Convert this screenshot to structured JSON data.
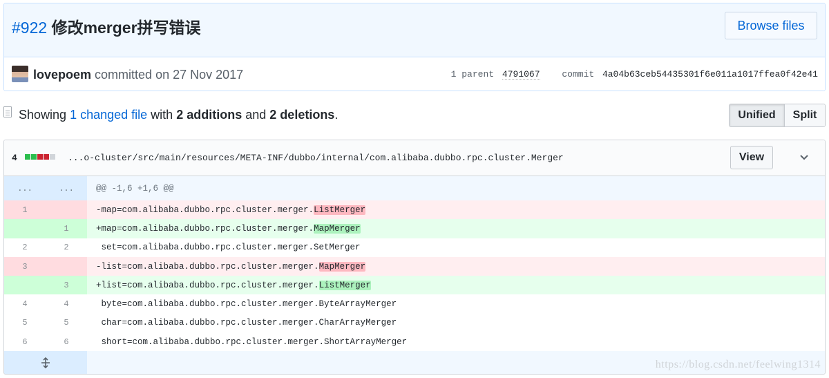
{
  "commit": {
    "pr_number": "#922",
    "title": "修改merger拼写错误",
    "browse_label": "Browse files",
    "author": "lovepoem",
    "committed_text": "committed on 27 Nov 2017",
    "parent_label": "1 parent",
    "parent_sha": "4791067",
    "commit_label": "commit",
    "commit_sha": "4a04b63ceb54435301f6e011a1017ffea0f42e41"
  },
  "toc": {
    "showing": "Showing",
    "changed_link": "1 changed file",
    "with": "with",
    "additions": "2 additions",
    "and": "and",
    "deletions": "2 deletions",
    "period": ".",
    "view_unified": "Unified",
    "view_split": "Split"
  },
  "file": {
    "change_count": "4",
    "path": "...o-cluster/src/main/resources/META-INF/dubbo/internal/com.alibaba.dubbo.rpc.cluster.Merger",
    "view_label": "View",
    "hunk": {
      "left": "...",
      "right": "...",
      "text": "@@ -1,6 +1,6 @@"
    },
    "lines": [
      {
        "type": "del",
        "old": "1",
        "new": "",
        "prefix": "-map=com.alibaba.dubbo.rpc.cluster.merger.",
        "hl": "ListMerger"
      },
      {
        "type": "add",
        "old": "",
        "new": "1",
        "prefix": "+map=com.alibaba.dubbo.rpc.cluster.merger.",
        "hl": "MapMerger"
      },
      {
        "type": "ctx",
        "old": "2",
        "new": "2",
        "prefix": " set=com.alibaba.dubbo.rpc.cluster.merger.SetMerger",
        "hl": ""
      },
      {
        "type": "del",
        "old": "3",
        "new": "",
        "prefix": "-list=com.alibaba.dubbo.rpc.cluster.merger.",
        "hl": "MapMerger"
      },
      {
        "type": "add",
        "old": "",
        "new": "3",
        "prefix": "+list=com.alibaba.dubbo.rpc.cluster.merger.",
        "hl": "ListMerger"
      },
      {
        "type": "ctx",
        "old": "4",
        "new": "4",
        "prefix": " byte=com.alibaba.dubbo.rpc.cluster.merger.ByteArrayMerger",
        "hl": ""
      },
      {
        "type": "ctx",
        "old": "5",
        "new": "5",
        "prefix": " char=com.alibaba.dubbo.rpc.cluster.merger.CharArrayMerger",
        "hl": ""
      },
      {
        "type": "ctx",
        "old": "6",
        "new": "6",
        "prefix": " short=com.alibaba.dubbo.rpc.cluster.merger.ShortArrayMerger",
        "hl": ""
      }
    ]
  },
  "watermark": "https://blog.csdn.net/feelwing1314"
}
